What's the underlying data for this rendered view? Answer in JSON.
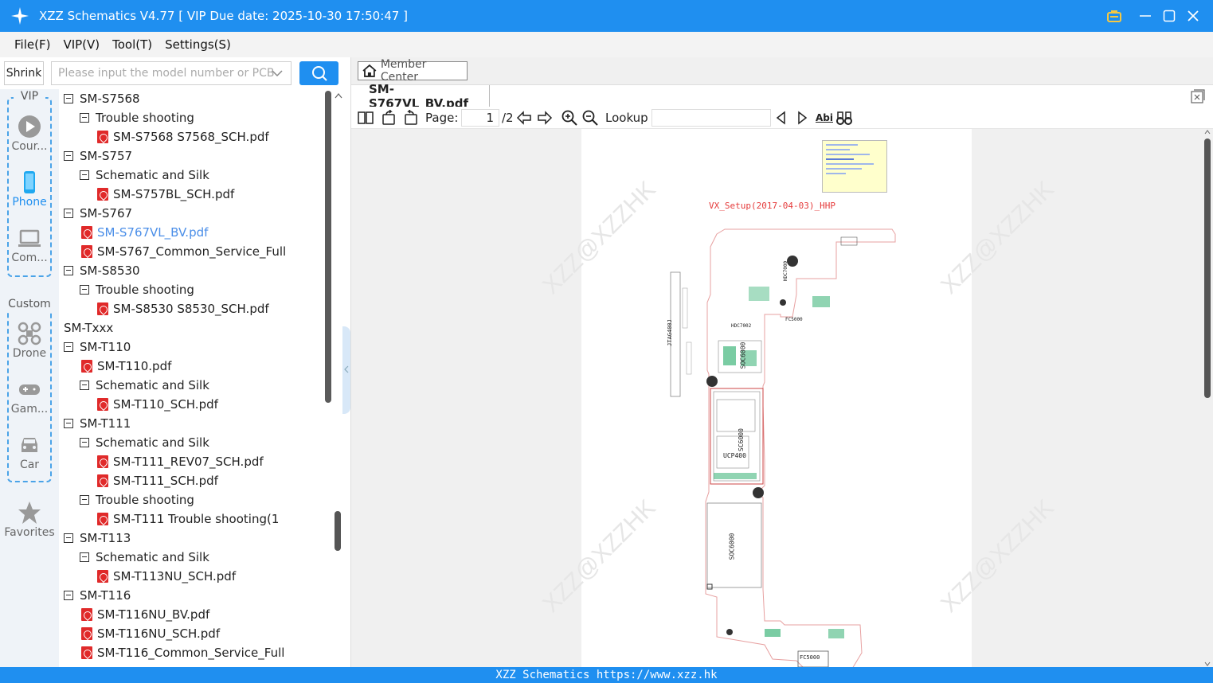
{
  "window": {
    "title": "XZZ Schematics V4.77 [ VIP Due date: 2025-10-30 17:50:47 ]"
  },
  "menu": [
    {
      "label": "File(F)"
    },
    {
      "label": "VIP(V)"
    },
    {
      "label": "Tool(T)"
    },
    {
      "label": "Settings(S)"
    }
  ],
  "left": {
    "shrink_label": "Shrink",
    "search_placeholder": "Please input the model number or PCB"
  },
  "sidebar": {
    "vip_label": "VIP",
    "custom_label": "Custom",
    "items": [
      {
        "label": "Cour...",
        "icon": "play-icon"
      },
      {
        "label": "Phone",
        "icon": "phone-icon"
      },
      {
        "label": "Com...",
        "icon": "laptop-icon"
      },
      {
        "label": "Drone",
        "icon": "drone-icon"
      },
      {
        "label": "Gam...",
        "icon": "gamepad-icon"
      },
      {
        "label": "Car",
        "icon": "car-icon"
      },
      {
        "label": "Favorites",
        "icon": "star-icon"
      }
    ]
  },
  "tree": [
    {
      "label": "SM-S7568",
      "kind": "folder",
      "level": 2
    },
    {
      "label": "Trouble shooting",
      "kind": "folder",
      "level": 3
    },
    {
      "label": "SM-S7568 S7568_SCH.pdf",
      "kind": "pdf",
      "level": 4
    },
    {
      "label": "SM-S757",
      "kind": "folder",
      "level": 2
    },
    {
      "label": "Schematic and Silk",
      "kind": "folder",
      "level": 3
    },
    {
      "label": "SM-S757BL_SCH.pdf",
      "kind": "pdf",
      "level": 4
    },
    {
      "label": "SM-S767",
      "kind": "folder",
      "level": 2
    },
    {
      "label": "SM-S767VL_BV.pdf",
      "kind": "pdf",
      "level": 3,
      "selected": true
    },
    {
      "label": "SM-S767_Common_Service_Full",
      "kind": "pdf",
      "level": 3
    },
    {
      "label": "SM-S8530",
      "kind": "folder",
      "level": 2
    },
    {
      "label": "Trouble shooting",
      "kind": "folder",
      "level": 3
    },
    {
      "label": "SM-S8530 S8530_SCH.pdf",
      "kind": "pdf",
      "level": 4
    },
    {
      "label": "SM-Txxx",
      "kind": "folder",
      "level": 1
    },
    {
      "label": "SM-T110",
      "kind": "folder",
      "level": 2
    },
    {
      "label": "SM-T110.pdf",
      "kind": "pdf",
      "level": 3
    },
    {
      "label": "Schematic and Silk",
      "kind": "folder",
      "level": 3
    },
    {
      "label": "SM-T110_SCH.pdf",
      "kind": "pdf",
      "level": 4
    },
    {
      "label": "SM-T111",
      "kind": "folder",
      "level": 2
    },
    {
      "label": "Schematic and Silk",
      "kind": "folder",
      "level": 3
    },
    {
      "label": "SM-T111_REV07_SCH.pdf",
      "kind": "pdf",
      "level": 4
    },
    {
      "label": "SM-T111_SCH.pdf",
      "kind": "pdf",
      "level": 4
    },
    {
      "label": "Trouble shooting",
      "kind": "folder",
      "level": 3
    },
    {
      "label": "SM-T111 Trouble shooting(1",
      "kind": "pdf",
      "level": 4
    },
    {
      "label": "SM-T113",
      "kind": "folder",
      "level": 2
    },
    {
      "label": "Schematic and Silk",
      "kind": "folder",
      "level": 3
    },
    {
      "label": "SM-T113NU_SCH.pdf",
      "kind": "pdf",
      "level": 4
    },
    {
      "label": "SM-T116",
      "kind": "folder",
      "level": 2
    },
    {
      "label": "SM-T116NU_BV.pdf",
      "kind": "pdf",
      "level": 3
    },
    {
      "label": "SM-T116NU_SCH.pdf",
      "kind": "pdf",
      "level": 3
    },
    {
      "label": "SM-T116_Common_Service_Full",
      "kind": "pdf",
      "level": 3
    }
  ],
  "viewer": {
    "member_center": "Member Center",
    "tab_label": "SM-S767VL_BV.pdf",
    "page_label": "Page:",
    "page_current": "1",
    "page_total": "/2",
    "lookup_label": "Lookup",
    "doc_heading": "VX_Setup(2017-04-03)_HHP",
    "watermark": "XZZ@XZZHK",
    "chips": [
      "HDC7000",
      "HDC7002",
      "JTAG400J",
      "SOC6000",
      "UCP400",
      "SC6000",
      "FC5000",
      "FC5000",
      "SOC6000"
    ]
  },
  "footer": {
    "text": "XZZ Schematics https://www.xzz.hk"
  }
}
